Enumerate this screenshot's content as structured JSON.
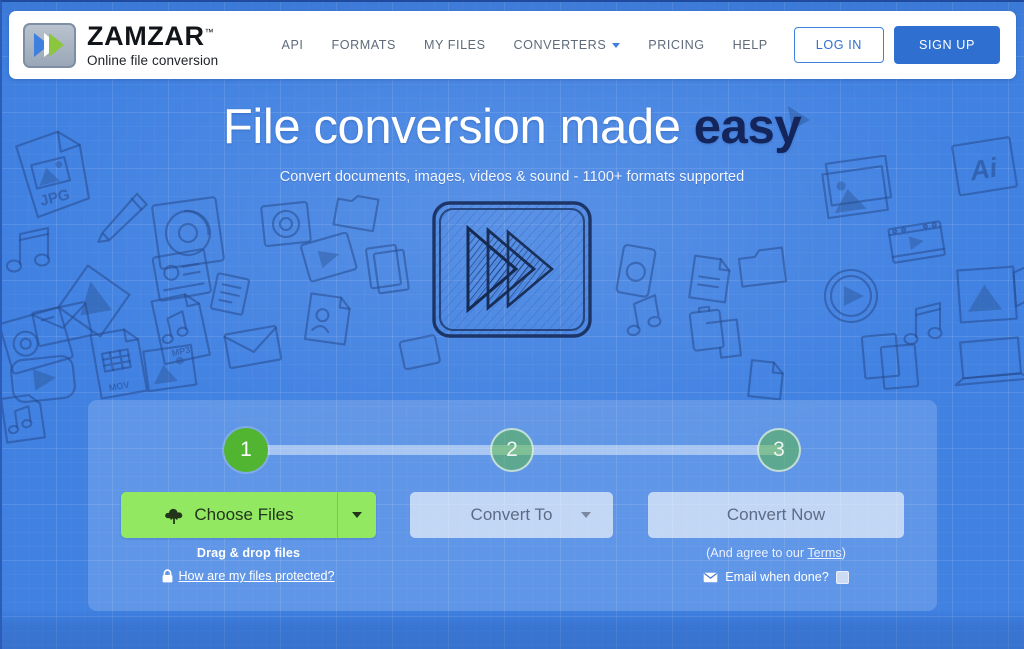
{
  "brand": {
    "name": "ZAMZAR",
    "trademark": "™",
    "tagline": "Online file conversion",
    "logo_icon": "double-chevron-logo-icon",
    "logo_blue": "#3f7fe0",
    "logo_green": "#8cc63f"
  },
  "nav": {
    "items": [
      {
        "label": "API",
        "icon": ""
      },
      {
        "label": "FORMATS",
        "icon": ""
      },
      {
        "label": "MY FILES",
        "icon": ""
      },
      {
        "label": "CONVERTERS",
        "icon": "chevron-down-icon"
      },
      {
        "label": "PRICING",
        "icon": ""
      },
      {
        "label": "HELP",
        "icon": ""
      }
    ],
    "login_label": "LOG IN",
    "signup_label": "SIGN UP",
    "accent": "#2f6fd0"
  },
  "hero": {
    "title_plain": "File conversion made ",
    "title_emphasis": "easy",
    "subtitle": "Convert documents, images, videos & sound - 1100+ formats supported",
    "art_icon": "sketch-triple-triangle-logo-icon",
    "background": "#4081e2",
    "emphasis_color": "#14255c"
  },
  "converter": {
    "steps": [
      {
        "number": "1",
        "state": "active"
      },
      {
        "number": "2",
        "state": "idle"
      },
      {
        "number": "3",
        "state": "idle"
      }
    ],
    "step_active_color": "#52b532",
    "choose_files": {
      "label": "Choose Files",
      "icon": "cloud-upload-icon",
      "caret_icon": "caret-down-icon",
      "color": "#92e861"
    },
    "convert_to": {
      "label": "Convert To",
      "caret_icon": "caret-down-icon"
    },
    "convert_now": {
      "label": "Convert Now"
    },
    "drag_drop_text": "Drag & drop files",
    "protected_link": "How are my files protected?",
    "protected_icon": "lock-icon",
    "terms_prefix": "(And agree to our ",
    "terms_link": "Terms",
    "terms_suffix": ")",
    "email_label": "Email when done?",
    "email_icon": "envelope-icon",
    "email_checked": false
  },
  "doodles": {
    "labels": [
      "JPG",
      "MP3",
      "MOV",
      "Ai"
    ],
    "description": "hand-drawn blueprint file-type icons"
  }
}
